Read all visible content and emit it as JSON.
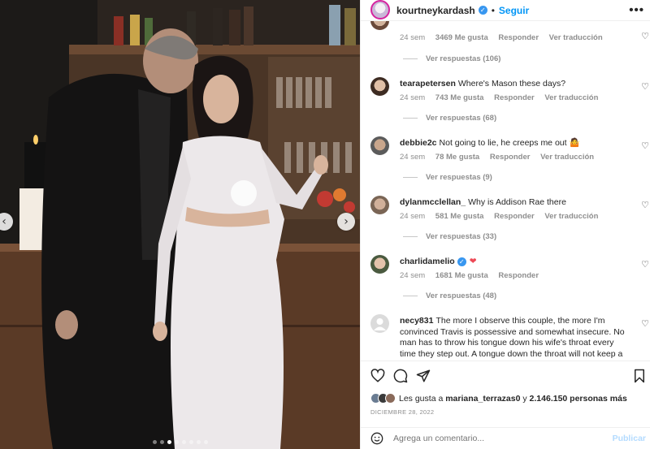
{
  "post": {
    "username": "kourtneykardash",
    "follow_label": "Seguir",
    "separator": "•",
    "more_label": "•••"
  },
  "photo": {
    "prev_arrow": "‹",
    "next_arrow": "›",
    "dot_count": 8,
    "active_dot": 2
  },
  "comments": [
    {
      "id": "top",
      "username": "",
      "text": "",
      "time": "24 sem",
      "likes": "3469 Me gusta",
      "reply": "Responder",
      "translate": "Ver traducción",
      "replies": "Ver respuestas (106)"
    },
    {
      "id": "tearapetersen",
      "username": "tearapetersen",
      "text": "Where's Mason these days?",
      "time": "24 sem",
      "likes": "743 Me gusta",
      "reply": "Responder",
      "translate": "Ver traducción",
      "replies": "Ver respuestas (68)"
    },
    {
      "id": "debbie2c",
      "username": "debbie2c",
      "text": "Not going to lie, he creeps me out 🤷",
      "time": "24 sem",
      "likes": "78 Me gusta",
      "reply": "Responder",
      "translate": "Ver traducción",
      "replies": "Ver respuestas (9)"
    },
    {
      "id": "dylanmcclellan",
      "username": "dylanmcclellan_",
      "text": "Why is Addison Rae there",
      "time": "24 sem",
      "likes": "581 Me gusta",
      "reply": "Responder",
      "translate": "Ver traducción",
      "replies": "Ver respuestas (33)"
    },
    {
      "id": "charlidamelio",
      "username": "charlidamelio",
      "text": "❤",
      "time": "24 sem",
      "likes": "1681 Me gusta",
      "reply": "Responder",
      "translate": "",
      "replies": "Ver respuestas (48)"
    },
    {
      "id": "necy831",
      "username": "necy831",
      "text": "The more I observe this couple, the more I'm convinced Travis is possessive and somewhat insecure. No man has to throw his tongue down his wife's throat every time they step out. A tongue down the throat will not keep a marriage"
    }
  ],
  "likes_bar": {
    "prefix": "Les gusta a",
    "user": "mariana_terrazas0",
    "conj": "y",
    "count": "2.146.150 personas más"
  },
  "date": "DICIEMBRE 28, 2022",
  "add_comment": {
    "placeholder": "Agrega un comentario...",
    "publish": "Publicar"
  },
  "colors": {
    "link_blue": "#0095f6",
    "verified_blue": "#3897f0",
    "heart_red": "#ed4956",
    "muted": "#8e8e8e"
  }
}
